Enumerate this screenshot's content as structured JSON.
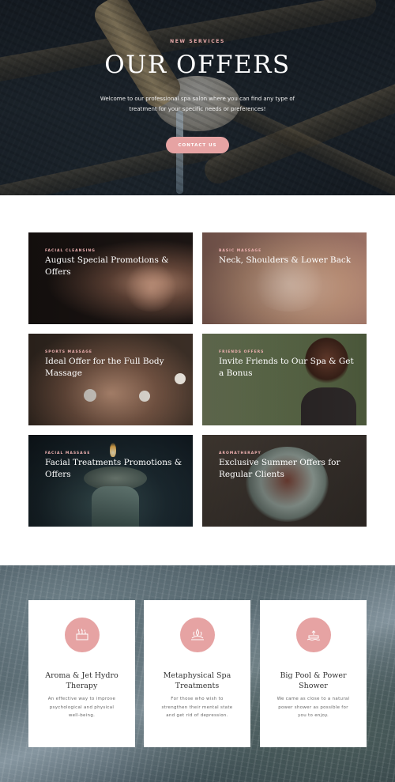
{
  "hero": {
    "kicker": "NEW SERVICES",
    "title": "OUR OFFERS",
    "subtitle": "Welcome to our professional spa salon where you can find any type of treatment for your specific needs or preferences!",
    "button_label": "CONTACT US"
  },
  "offers": [
    {
      "category": "FACIAL CLEANSING",
      "title": "August Special Promotions & Offers"
    },
    {
      "category": "BASIC MASSAGE",
      "title": "Neck, Shoulders & Lower Back"
    },
    {
      "category": "SPORTS MASSAGE",
      "title": "Ideal Offer for the Full Body Massage"
    },
    {
      "category": "FRIENDS OFFERS",
      "title": "Invite Friends to Our Spa & Get a Bonus"
    },
    {
      "category": "FACIAL MASSAGE",
      "title": "Facial Treatments Promotions & Offers"
    },
    {
      "category": "AROMATHERAPY",
      "title": "Exclusive Summer Offers for Regular Clients"
    }
  ],
  "features": [
    {
      "icon": "hydro-therapy-icon",
      "title": "Aroma & Jet Hydro Therapy",
      "description": "An effective way to improve psychological and physical well-being."
    },
    {
      "icon": "spa-treatment-icon",
      "title": "Metaphysical Spa Treatments",
      "description": "For those who wish to strengthen their mental state and get rid of depression."
    },
    {
      "icon": "pool-shower-icon",
      "title": "Big Pool & Power Shower",
      "description": "We came as close to a natural power shower as possible for you to enjoy."
    }
  ],
  "colors": {
    "accent": "#e6a3a3",
    "kicker": "#e8a9a9",
    "dark": "#1b2128"
  }
}
